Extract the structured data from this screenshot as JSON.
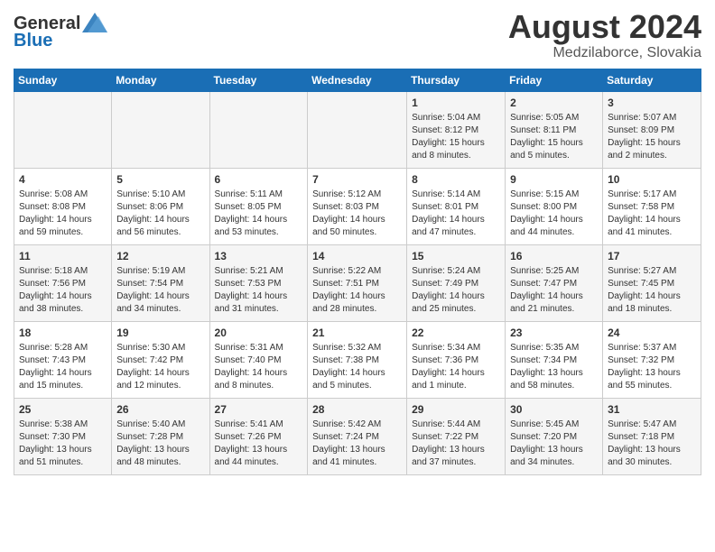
{
  "header": {
    "logo_general": "General",
    "logo_blue": "Blue",
    "main_title": "August 2024",
    "subtitle": "Medzilaborce, Slovakia"
  },
  "days_of_week": [
    "Sunday",
    "Monday",
    "Tuesday",
    "Wednesday",
    "Thursday",
    "Friday",
    "Saturday"
  ],
  "weeks": [
    [
      {
        "num": "",
        "detail": ""
      },
      {
        "num": "",
        "detail": ""
      },
      {
        "num": "",
        "detail": ""
      },
      {
        "num": "",
        "detail": ""
      },
      {
        "num": "1",
        "detail": "Sunrise: 5:04 AM\nSunset: 8:12 PM\nDaylight: 15 hours\nand 8 minutes."
      },
      {
        "num": "2",
        "detail": "Sunrise: 5:05 AM\nSunset: 8:11 PM\nDaylight: 15 hours\nand 5 minutes."
      },
      {
        "num": "3",
        "detail": "Sunrise: 5:07 AM\nSunset: 8:09 PM\nDaylight: 15 hours\nand 2 minutes."
      }
    ],
    [
      {
        "num": "4",
        "detail": "Sunrise: 5:08 AM\nSunset: 8:08 PM\nDaylight: 14 hours\nand 59 minutes."
      },
      {
        "num": "5",
        "detail": "Sunrise: 5:10 AM\nSunset: 8:06 PM\nDaylight: 14 hours\nand 56 minutes."
      },
      {
        "num": "6",
        "detail": "Sunrise: 5:11 AM\nSunset: 8:05 PM\nDaylight: 14 hours\nand 53 minutes."
      },
      {
        "num": "7",
        "detail": "Sunrise: 5:12 AM\nSunset: 8:03 PM\nDaylight: 14 hours\nand 50 minutes."
      },
      {
        "num": "8",
        "detail": "Sunrise: 5:14 AM\nSunset: 8:01 PM\nDaylight: 14 hours\nand 47 minutes."
      },
      {
        "num": "9",
        "detail": "Sunrise: 5:15 AM\nSunset: 8:00 PM\nDaylight: 14 hours\nand 44 minutes."
      },
      {
        "num": "10",
        "detail": "Sunrise: 5:17 AM\nSunset: 7:58 PM\nDaylight: 14 hours\nand 41 minutes."
      }
    ],
    [
      {
        "num": "11",
        "detail": "Sunrise: 5:18 AM\nSunset: 7:56 PM\nDaylight: 14 hours\nand 38 minutes."
      },
      {
        "num": "12",
        "detail": "Sunrise: 5:19 AM\nSunset: 7:54 PM\nDaylight: 14 hours\nand 34 minutes."
      },
      {
        "num": "13",
        "detail": "Sunrise: 5:21 AM\nSunset: 7:53 PM\nDaylight: 14 hours\nand 31 minutes."
      },
      {
        "num": "14",
        "detail": "Sunrise: 5:22 AM\nSunset: 7:51 PM\nDaylight: 14 hours\nand 28 minutes."
      },
      {
        "num": "15",
        "detail": "Sunrise: 5:24 AM\nSunset: 7:49 PM\nDaylight: 14 hours\nand 25 minutes."
      },
      {
        "num": "16",
        "detail": "Sunrise: 5:25 AM\nSunset: 7:47 PM\nDaylight: 14 hours\nand 21 minutes."
      },
      {
        "num": "17",
        "detail": "Sunrise: 5:27 AM\nSunset: 7:45 PM\nDaylight: 14 hours\nand 18 minutes."
      }
    ],
    [
      {
        "num": "18",
        "detail": "Sunrise: 5:28 AM\nSunset: 7:43 PM\nDaylight: 14 hours\nand 15 minutes."
      },
      {
        "num": "19",
        "detail": "Sunrise: 5:30 AM\nSunset: 7:42 PM\nDaylight: 14 hours\nand 12 minutes."
      },
      {
        "num": "20",
        "detail": "Sunrise: 5:31 AM\nSunset: 7:40 PM\nDaylight: 14 hours\nand 8 minutes."
      },
      {
        "num": "21",
        "detail": "Sunrise: 5:32 AM\nSunset: 7:38 PM\nDaylight: 14 hours\nand 5 minutes."
      },
      {
        "num": "22",
        "detail": "Sunrise: 5:34 AM\nSunset: 7:36 PM\nDaylight: 14 hours\nand 1 minute."
      },
      {
        "num": "23",
        "detail": "Sunrise: 5:35 AM\nSunset: 7:34 PM\nDaylight: 13 hours\nand 58 minutes."
      },
      {
        "num": "24",
        "detail": "Sunrise: 5:37 AM\nSunset: 7:32 PM\nDaylight: 13 hours\nand 55 minutes."
      }
    ],
    [
      {
        "num": "25",
        "detail": "Sunrise: 5:38 AM\nSunset: 7:30 PM\nDaylight: 13 hours\nand 51 minutes."
      },
      {
        "num": "26",
        "detail": "Sunrise: 5:40 AM\nSunset: 7:28 PM\nDaylight: 13 hours\nand 48 minutes."
      },
      {
        "num": "27",
        "detail": "Sunrise: 5:41 AM\nSunset: 7:26 PM\nDaylight: 13 hours\nand 44 minutes."
      },
      {
        "num": "28",
        "detail": "Sunrise: 5:42 AM\nSunset: 7:24 PM\nDaylight: 13 hours\nand 41 minutes."
      },
      {
        "num": "29",
        "detail": "Sunrise: 5:44 AM\nSunset: 7:22 PM\nDaylight: 13 hours\nand 37 minutes."
      },
      {
        "num": "30",
        "detail": "Sunrise: 5:45 AM\nSunset: 7:20 PM\nDaylight: 13 hours\nand 34 minutes."
      },
      {
        "num": "31",
        "detail": "Sunrise: 5:47 AM\nSunset: 7:18 PM\nDaylight: 13 hours\nand 30 minutes."
      }
    ]
  ]
}
